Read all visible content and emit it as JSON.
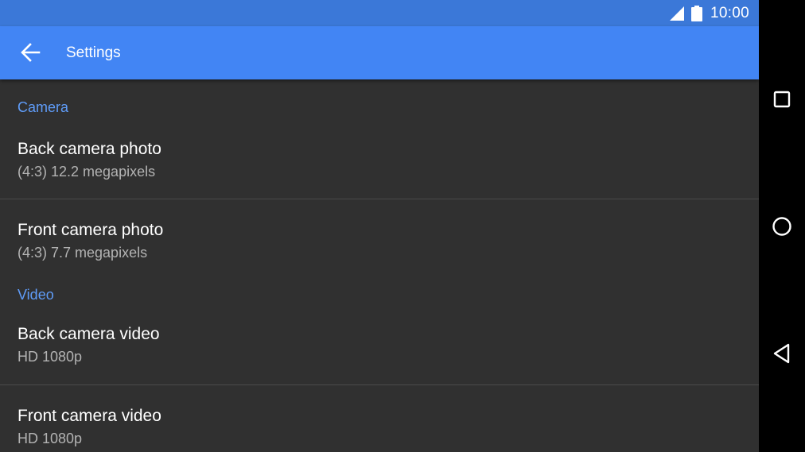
{
  "status_bar": {
    "time": "10:00",
    "icons": [
      "cellular-signal-icon",
      "battery-icon"
    ]
  },
  "app_bar": {
    "title": "Settings",
    "back_icon": "arrow-back-icon"
  },
  "sections": [
    {
      "header": "Camera",
      "items": [
        {
          "title": "Back camera photo",
          "summary": "(4:3) 12.2 megapixels"
        },
        {
          "title": "Front camera photo",
          "summary": "(4:3) 7.7 megapixels"
        }
      ]
    },
    {
      "header": "Video",
      "items": [
        {
          "title": "Back camera video",
          "summary": "HD 1080p"
        },
        {
          "title": "Front camera video",
          "summary": "HD 1080p"
        }
      ]
    }
  ],
  "nav_bar": {
    "buttons": [
      "recents-icon",
      "home-icon",
      "back-icon"
    ]
  },
  "colors": {
    "status_bar": "#3b78d8",
    "app_bar": "#4285f4",
    "section_header": "#5f9cf8",
    "background": "#303030",
    "primary_text": "#ffffff",
    "secondary_text": "#b3b3b3"
  }
}
